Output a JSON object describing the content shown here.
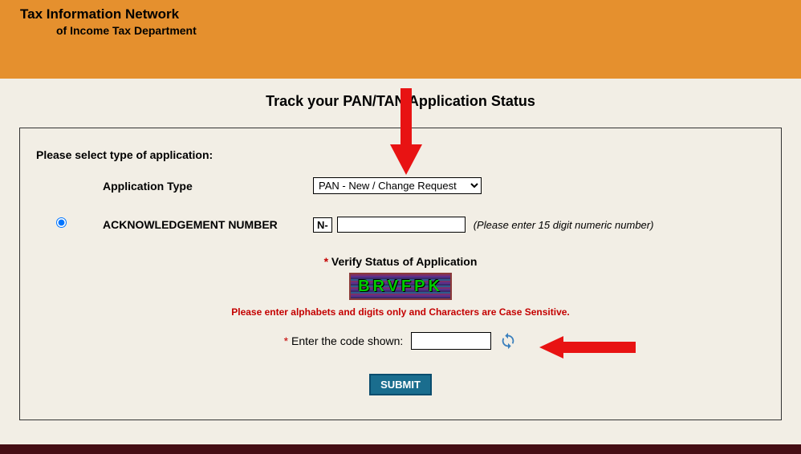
{
  "header": {
    "title": "Tax Information Network",
    "subtitle": "of Income Tax Department"
  },
  "page_title": "Track your PAN/TAN Application Status",
  "form": {
    "select_label": "Please select type of application:",
    "app_type_label": "Application Type",
    "app_type_value": "PAN - New / Change Request",
    "ack_label": "ACKNOWLEDGEMENT NUMBER",
    "ack_prefix": "N-",
    "ack_hint": "(Please enter 15 digit numeric number)",
    "verify_title": "Verify Status of Application",
    "captcha_text": "BRVFPK",
    "captcha_warning": "Please enter alphabets and digits only and Characters are Case Sensitive.",
    "captcha_label": "Enter the code shown:",
    "submit_label": "SUBMIT"
  }
}
